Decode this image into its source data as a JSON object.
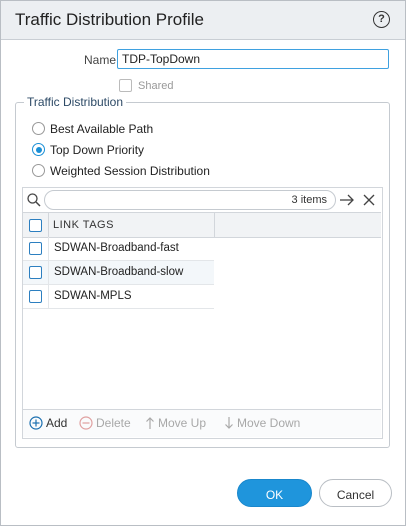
{
  "dialog": {
    "title": "Traffic Distribution Profile"
  },
  "form": {
    "name_label": "Name",
    "name_value": "TDP-TopDown",
    "shared_label": "Shared",
    "shared_checked": false
  },
  "traffic_distribution": {
    "legend": "Traffic Distribution",
    "options": [
      {
        "label": "Best Available Path",
        "selected": false
      },
      {
        "label": "Top Down Priority",
        "selected": true
      },
      {
        "label": "Weighted Session Distribution",
        "selected": false
      }
    ]
  },
  "grid": {
    "items_count": "3 items",
    "column_header": "LINK TAGS",
    "rows": [
      {
        "label": "SDWAN-Broadband-fast"
      },
      {
        "label": "SDWAN-Broadband-slow"
      },
      {
        "label": "SDWAN-MPLS"
      }
    ]
  },
  "toolbar": {
    "add_label": "Add",
    "delete_label": "Delete",
    "move_up_label": "Move Up",
    "move_down_label": "Move Down"
  },
  "buttons": {
    "ok_label": "OK",
    "cancel_label": "Cancel"
  },
  "colors": {
    "accent": "#1f95dc",
    "legend_text": "#2d4a66"
  }
}
